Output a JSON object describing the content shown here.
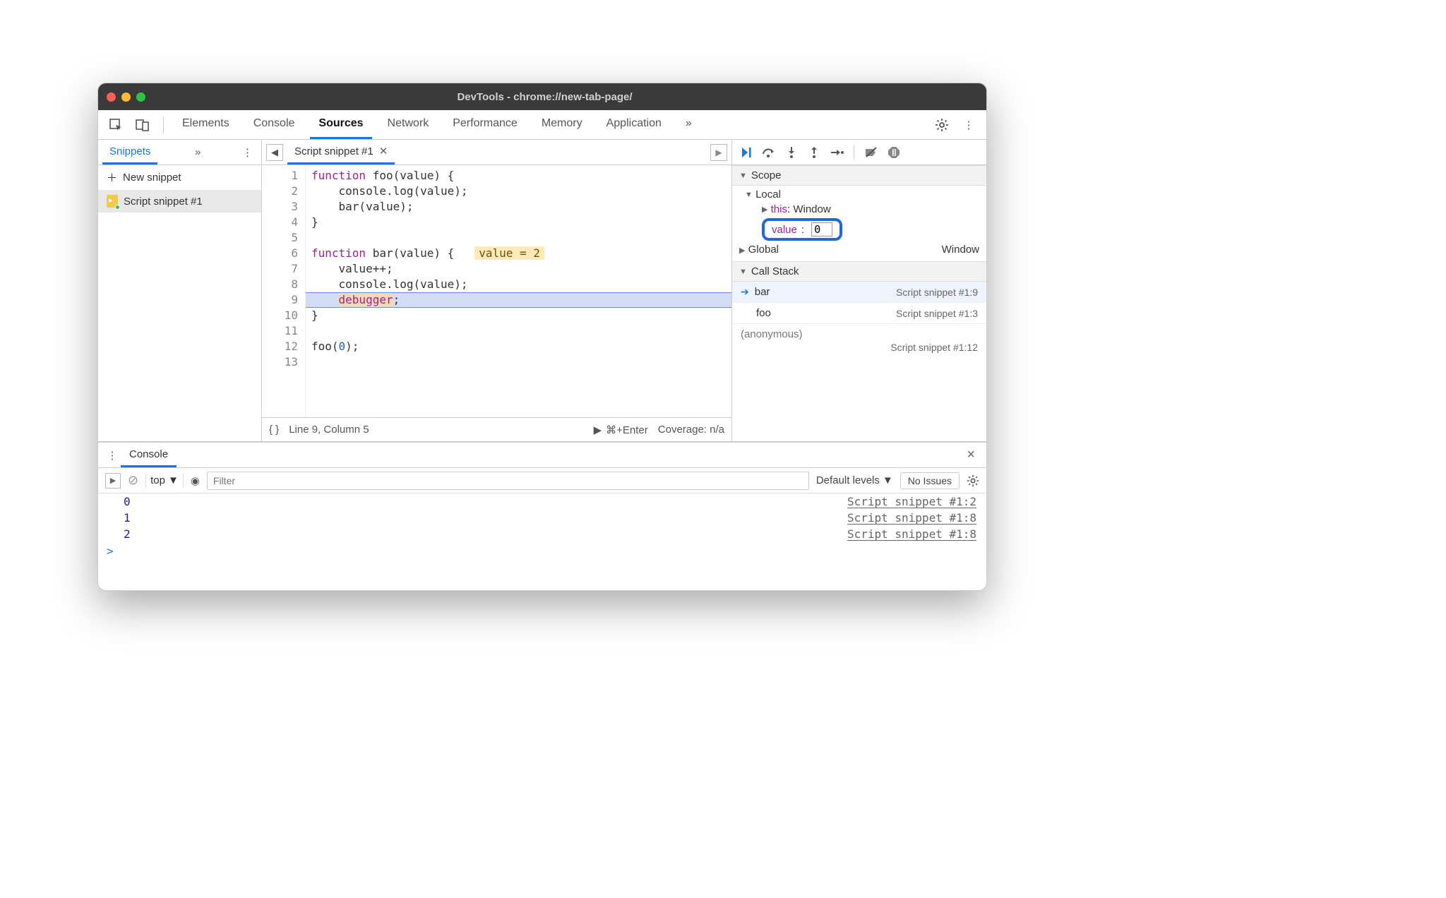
{
  "window": {
    "title": "DevTools - chrome://new-tab-page/"
  },
  "topnav": {
    "tabs": [
      "Elements",
      "Console",
      "Sources",
      "Network",
      "Performance",
      "Memory",
      "Application"
    ],
    "overflow": "»",
    "active": "Sources"
  },
  "sidebar": {
    "tab": "Snippets",
    "overflow": "»",
    "new_label": "New snippet",
    "items": [
      {
        "label": "Script snippet #1"
      }
    ]
  },
  "editor": {
    "tab": "Script snippet #1",
    "lines": [
      {
        "n": 1,
        "html": "<span class='kw'>function</span> foo(value) {"
      },
      {
        "n": 2,
        "html": "    console.log(value);"
      },
      {
        "n": 3,
        "html": "    bar(value);"
      },
      {
        "n": 4,
        "html": "}"
      },
      {
        "n": 5,
        "html": ""
      },
      {
        "n": 6,
        "html": "<span class='kw'>function</span> bar(value) {   <span class='inline-val'>value = 2</span>"
      },
      {
        "n": 7,
        "html": "    value++;"
      },
      {
        "n": 8,
        "html": "    console.log(value);"
      },
      {
        "n": 9,
        "html": "    <span class='dbg dbg-hl'>debugger</span>;",
        "hl": true
      },
      {
        "n": 10,
        "html": "}"
      },
      {
        "n": 11,
        "html": ""
      },
      {
        "n": 12,
        "html": "foo(<span class='num'>0</span>);"
      },
      {
        "n": 13,
        "html": ""
      }
    ],
    "status": {
      "pos": "Line 9, Column 5",
      "run": "⌘+Enter",
      "runicon": "▶",
      "coverage": "Coverage: n/a",
      "braces": "{ }"
    }
  },
  "debugger": {
    "scope_hd": "Scope",
    "local_hd": "Local",
    "this_name": "this",
    "this_val": "Window",
    "value_name": "value",
    "value_val": "0",
    "global_name": "Global",
    "global_val": "Window",
    "callstack_hd": "Call Stack",
    "stack": [
      {
        "fn": "bar",
        "loc": "Script snippet #1:9",
        "current": true
      },
      {
        "fn": "foo",
        "loc": "Script snippet #1:3"
      },
      {
        "fn": "(anonymous)",
        "loc": "Script snippet #1:12",
        "anon": true
      }
    ]
  },
  "console": {
    "tab": "Console",
    "context": "top",
    "filter_ph": "Filter",
    "levels": "Default levels",
    "noissues": "No Issues",
    "lines": [
      {
        "val": "0",
        "src": "Script snippet #1:2"
      },
      {
        "val": "1",
        "src": "Script snippet #1:8"
      },
      {
        "val": "2",
        "src": "Script snippet #1:8"
      }
    ],
    "prompt": ">"
  }
}
